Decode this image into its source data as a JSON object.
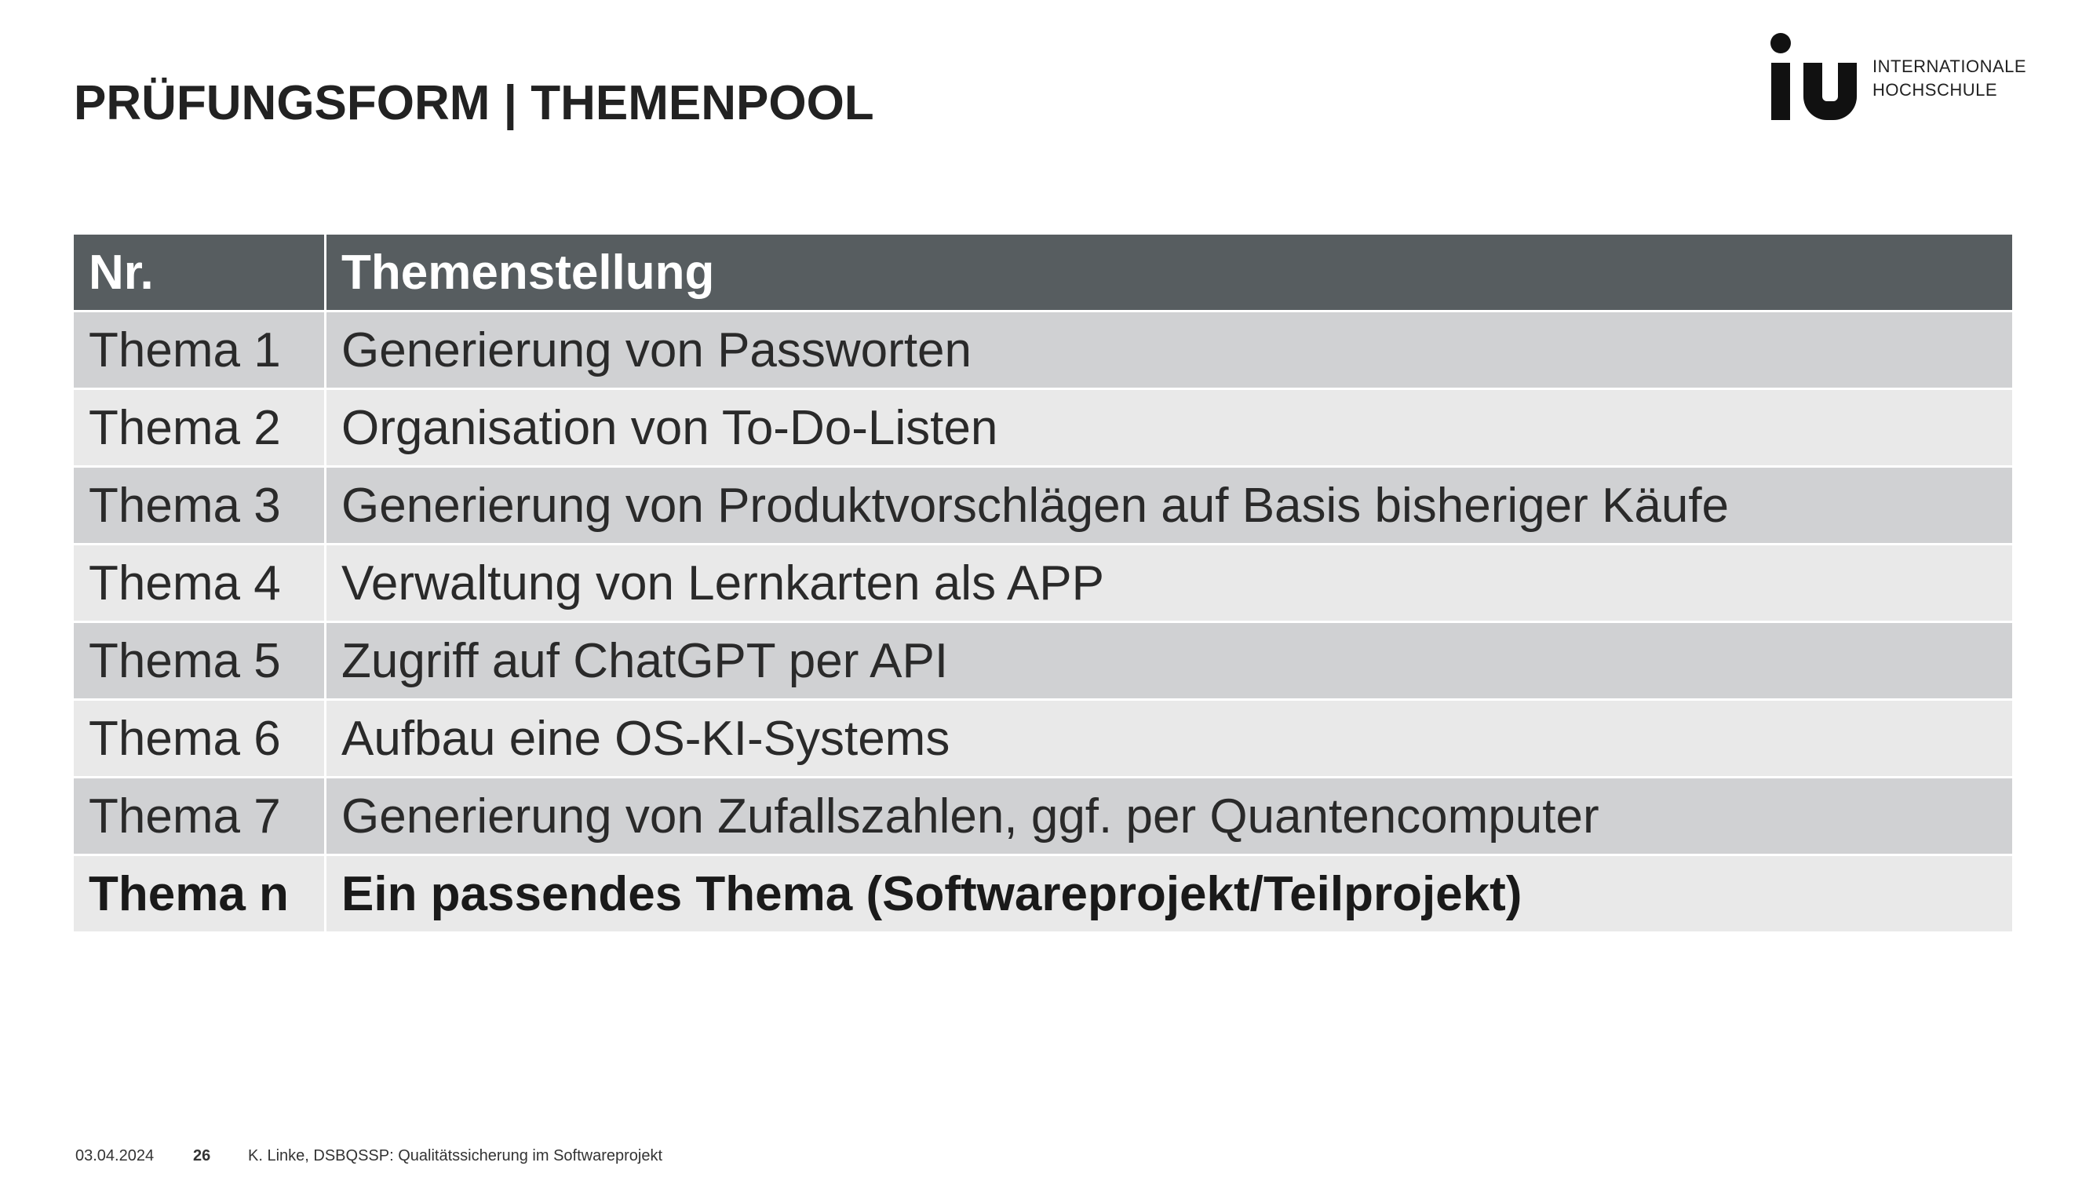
{
  "slide": {
    "title": "PRÜFUNGSFORM | THEMENPOOL"
  },
  "logo": {
    "mark": "iu",
    "line1": "INTERNATIONALE",
    "line2": "HOCHSCHULE"
  },
  "table": {
    "headers": [
      "Nr.",
      "Themenstellung"
    ],
    "rows": [
      {
        "nr": "Thema 1",
        "topic": "Generierung von Passworten"
      },
      {
        "nr": "Thema 2",
        "topic": "Organisation von To-Do-Listen"
      },
      {
        "nr": "Thema 3",
        "topic": "Generierung von Produktvorschlägen auf Basis bisheriger Käufe"
      },
      {
        "nr": "Thema 4",
        "topic": "Verwaltung von Lernkarten als APP"
      },
      {
        "nr": "Thema 5",
        "topic": "Zugriff auf ChatGPT per API"
      },
      {
        "nr": "Thema 6",
        "topic": "Aufbau eine OS-KI-Systems"
      },
      {
        "nr": "Thema 7",
        "topic": "Generierung von Zufallszahlen, ggf. per Quantencomputer"
      },
      {
        "nr": "Thema n",
        "topic": "Ein passendes Thema (Softwareprojekt/Teilprojekt)"
      }
    ]
  },
  "footer": {
    "date": "03.04.2024",
    "page": "26",
    "author": "K. Linke, ",
    "course": "DSBQSSP: Qualitätssicherung im Softwareprojekt"
  },
  "colors": {
    "header_bg": "#575d60",
    "row_dark": "#d0d1d3",
    "row_light": "#e9e9e9"
  }
}
